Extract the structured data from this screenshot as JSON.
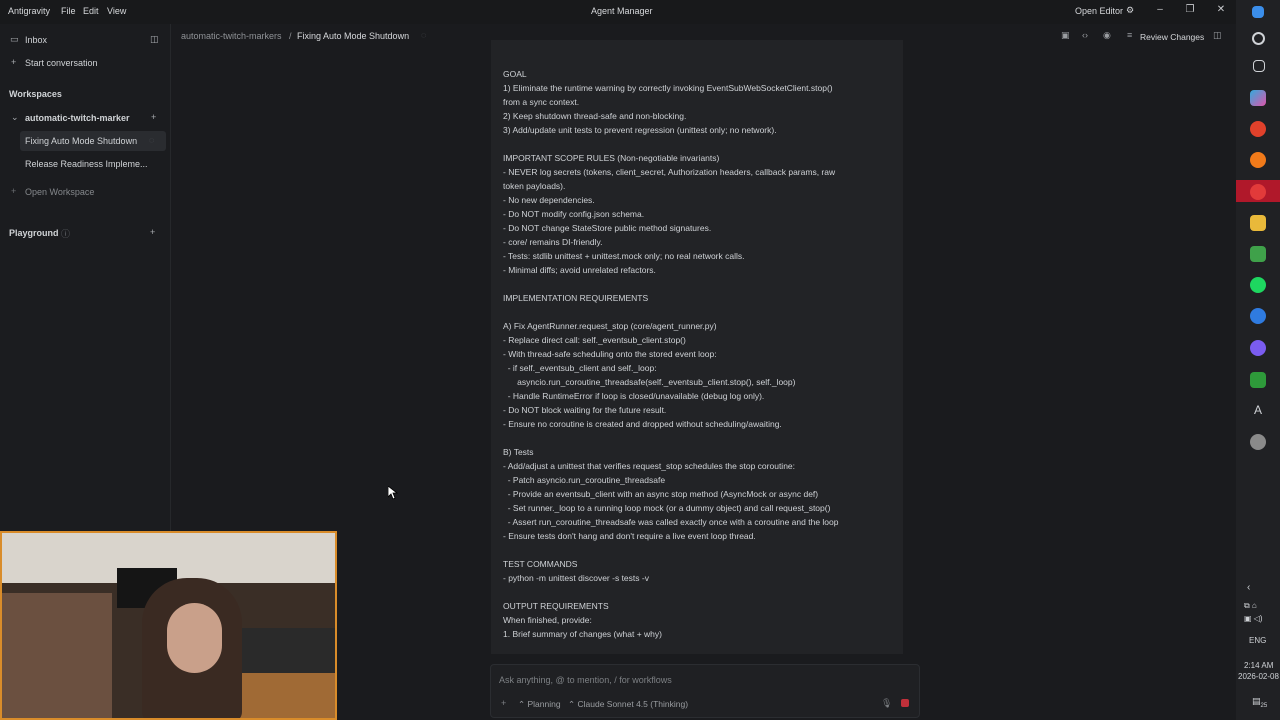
{
  "window": {
    "menus": [
      "Antigravity",
      "File",
      "Edit",
      "View"
    ],
    "title": "Agent Manager",
    "open_editor": "Open Editor"
  },
  "sidebar": {
    "inbox": "Inbox",
    "start_conversation": "Start conversation",
    "workspaces_heading": "Workspaces",
    "workspace_name": "automatic-twitch-marker",
    "conversations": [
      "Fixing Auto Mode Shutdown",
      "Release Readiness Impleme..."
    ],
    "open_workspace": "Open Workspace",
    "playground": "Playground"
  },
  "breadcrumb": {
    "workspace": "automatic-twitch-markers",
    "separator": "/",
    "conversation": "Fixing Auto Mode Shutdown",
    "review_changes": "Review Changes"
  },
  "document": {
    "lines": [
      "GOAL",
      "1) Eliminate the runtime warning by correctly invoking EventSubWebSocketClient.stop()",
      "from a sync context.",
      "2) Keep shutdown thread-safe and non-blocking.",
      "3) Add/update unit tests to prevent regression (unittest only; no network).",
      "",
      "IMPORTANT SCOPE RULES (Non-negotiable invariants)",
      "- NEVER log secrets (tokens, client_secret, Authorization headers, callback params, raw",
      "token payloads).",
      "- No new dependencies.",
      "- Do NOT modify config.json schema.",
      "- Do NOT change StateStore public method signatures.",
      "- core/ remains DI-friendly.",
      "- Tests: stdlib unittest + unittest.mock only; no real network calls.",
      "- Minimal diffs; avoid unrelated refactors.",
      "",
      "IMPLEMENTATION REQUIREMENTS",
      "",
      "A) Fix AgentRunner.request_stop (core/agent_runner.py)",
      "- Replace direct call: self._eventsub_client.stop()",
      "- With thread-safe scheduling onto the stored event loop:",
      "  - if self._eventsub_client and self._loop:",
      "      asyncio.run_coroutine_threadsafe(self._eventsub_client.stop(), self._loop)",
      "  - Handle RuntimeError if loop is closed/unavailable (debug log only).",
      "- Do NOT block waiting for the future result.",
      "- Ensure no coroutine is created and dropped without scheduling/awaiting.",
      "",
      "B) Tests",
      "- Add/adjust a unittest that verifies request_stop schedules the stop coroutine:",
      "  - Patch asyncio.run_coroutine_threadsafe",
      "  - Provide an eventsub_client with an async stop method (AsyncMock or async def)",
      "  - Set runner._loop to a running loop mock (or a dummy object) and call request_stop()",
      "  - Assert run_coroutine_threadsafe was called exactly once with a coroutine and the loop",
      "- Ensure tests don't hang and don't require a live event loop thread.",
      "",
      "TEST COMMANDS",
      "- python -m unittest discover -s tests -v",
      "",
      "OUTPUT REQUIREMENTS",
      "When finished, provide:",
      "1. Brief summary of changes (what + why)"
    ]
  },
  "input": {
    "placeholder": "Ask anything, @ to mention, / for workflows",
    "mode": "Planning",
    "model": "Claude Sonnet 4.5 (Thinking)"
  },
  "taskbar": {
    "lang": "ENG",
    "time": "2:14 AM",
    "date": "2026-02-08",
    "notif_count": "25"
  }
}
